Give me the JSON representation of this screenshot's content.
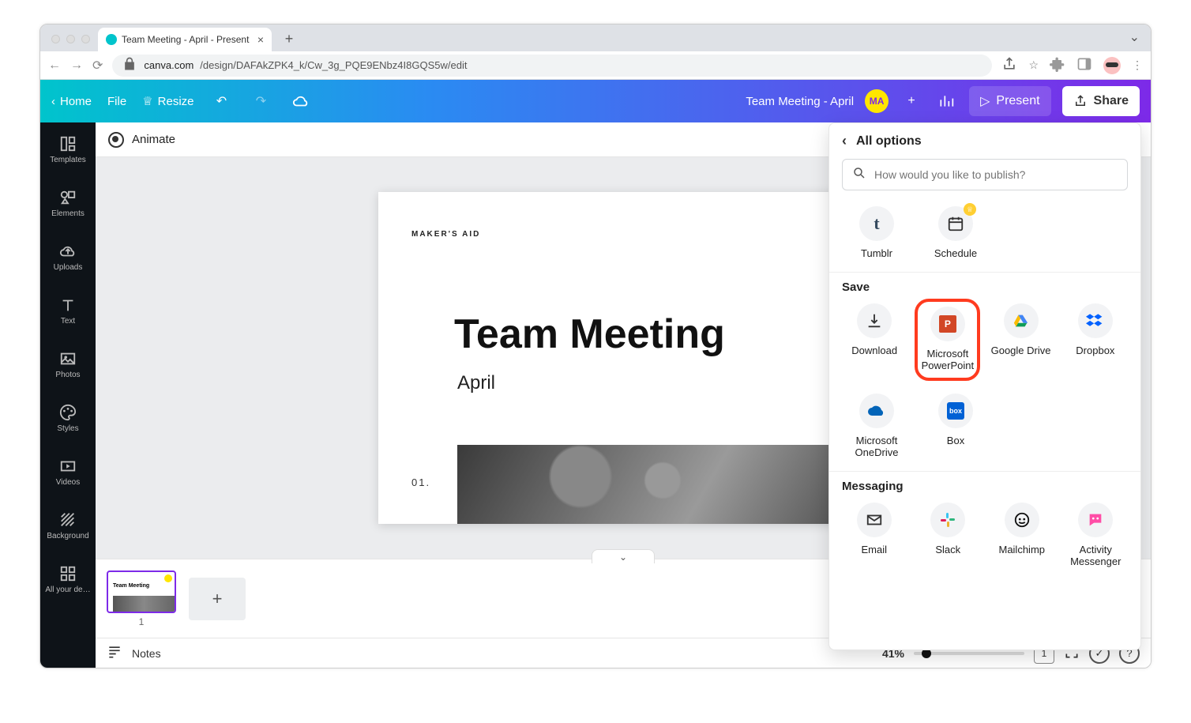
{
  "browser": {
    "tab_title": "Team Meeting - April - Present",
    "url_host": "canva.com",
    "url_path": "/design/DAFAkZPK4_k/Cw_3g_PQE9ENbz4I8GQS5w/edit"
  },
  "topbar": {
    "home": "Home",
    "file": "File",
    "resize": "Resize",
    "doc_title": "Team Meeting - April",
    "avatar_initials": "MA",
    "present": "Present",
    "share": "Share"
  },
  "rail": {
    "templates": "Templates",
    "elements": "Elements",
    "uploads": "Uploads",
    "text": "Text",
    "photos": "Photos",
    "styles": "Styles",
    "videos": "Videos",
    "background": "Background",
    "all_your_designs": "All your de…"
  },
  "editor": {
    "animate": "Animate",
    "slide_eyebrow": "MAKER'S AID",
    "slide_heading": "Team Meeting",
    "slide_subheading": "April",
    "slide_number": "01.",
    "thumb_index": "1",
    "notes": "Notes",
    "zoom_pct": "41%",
    "grid_count": "1"
  },
  "share_panel": {
    "title": "All options",
    "search_placeholder": "How would you like to publish?",
    "top_row": {
      "tumblr": "Tumblr",
      "schedule": "Schedule"
    },
    "save_title": "Save",
    "save_items": {
      "download": "Download",
      "ms_ppt": "Microsoft PowerPoint",
      "google_drive": "Google Drive",
      "dropbox": "Dropbox",
      "ms_onedrive": "Microsoft OneDrive",
      "box": "Box"
    },
    "messaging_title": "Messaging",
    "messaging_items": {
      "email": "Email",
      "slack": "Slack",
      "mailchimp": "Mailchimp",
      "activity_messenger": "Activity Messenger"
    }
  }
}
